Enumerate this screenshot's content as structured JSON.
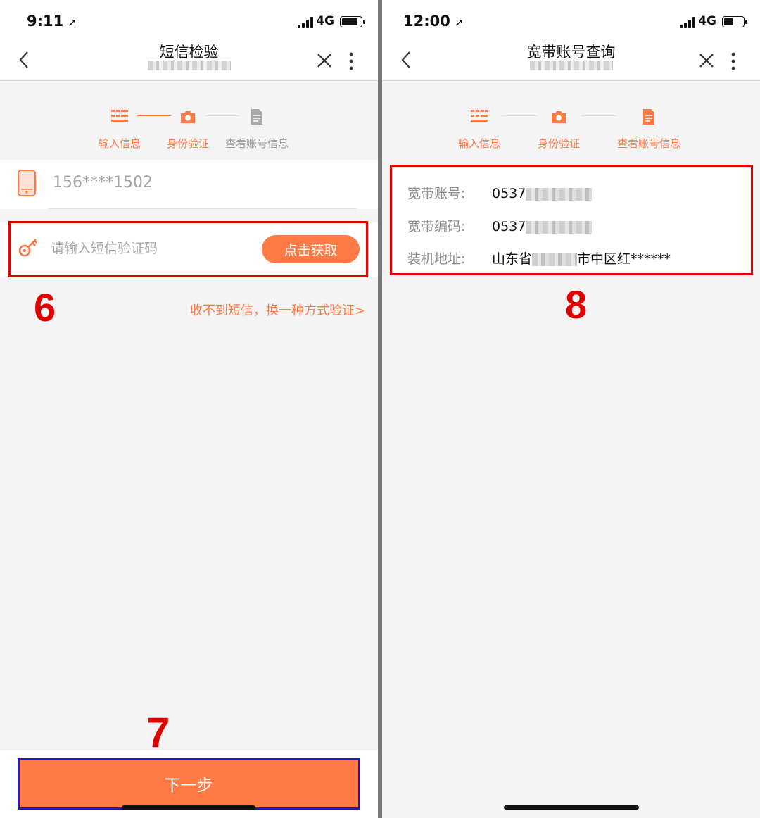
{
  "left": {
    "status": {
      "time": "9:11",
      "network": "4G"
    },
    "nav": {
      "title": "短信检验"
    },
    "steps": [
      "输入信息",
      "身份验证",
      "查看账号信息"
    ],
    "phone": "156****1502",
    "sms": {
      "placeholder": "请输入短信验证码",
      "get_code": "点击获取"
    },
    "alt_link": "收不到短信，换一种方式验证>",
    "next": "下一步"
  },
  "right": {
    "status": {
      "time": "12:00",
      "network": "4G"
    },
    "nav": {
      "title": "宽带账号查询"
    },
    "steps": [
      "输入信息",
      "身份验证",
      "查看账号信息"
    ],
    "info": [
      {
        "label": "宽带账号:",
        "value": "0537"
      },
      {
        "label": "宽带编码:",
        "value": "0537"
      },
      {
        "label": "装机地址:",
        "value": "山东省",
        "value2": "市中区红******"
      }
    ]
  },
  "annotations": [
    "6",
    "7",
    "8"
  ],
  "colors": {
    "accent": "#ff7a45",
    "annotation_red": "#e30000",
    "annotation_blue": "#1717e6"
  }
}
